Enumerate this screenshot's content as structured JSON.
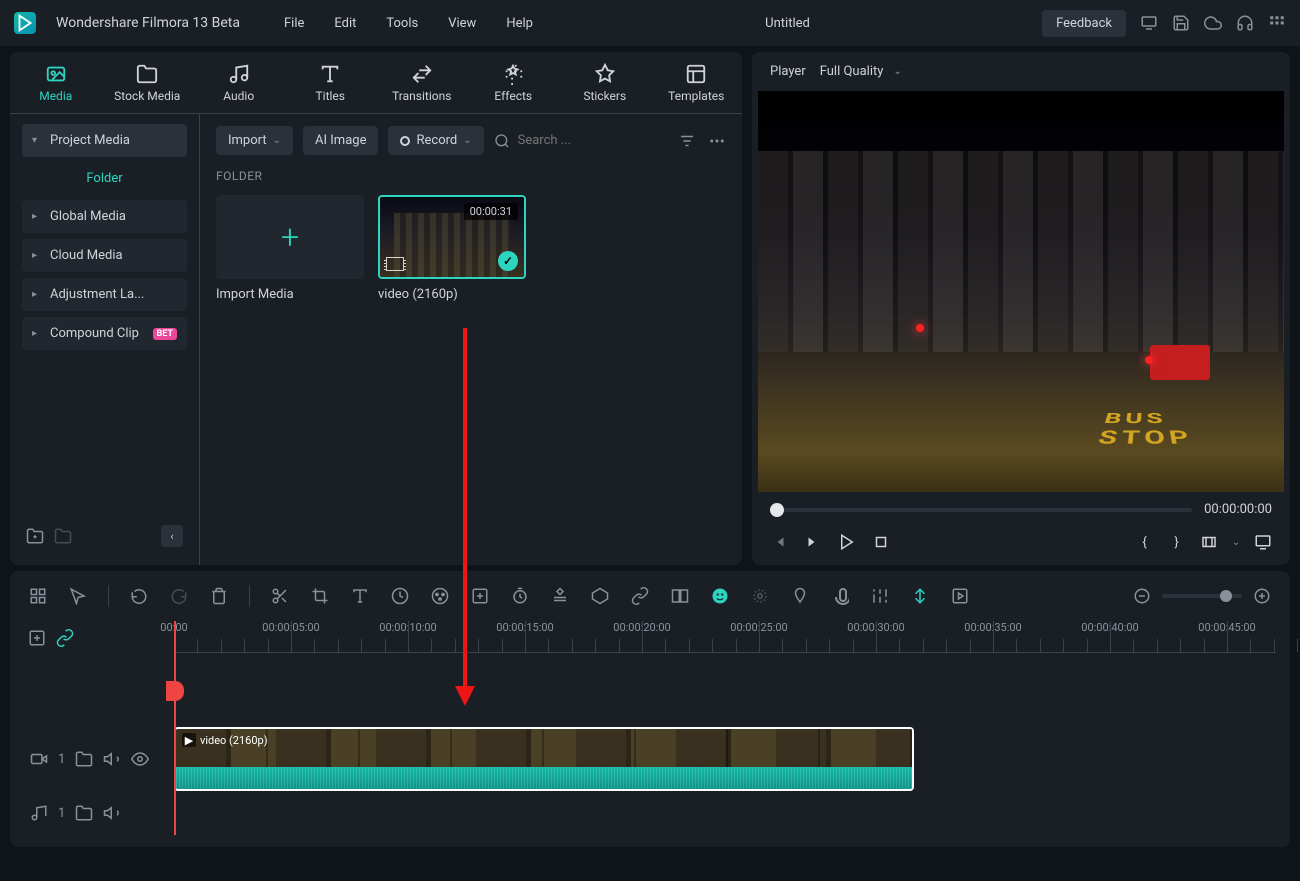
{
  "app": {
    "name": "Wondershare Filmora 13 Beta",
    "document": "Untitled"
  },
  "menu": {
    "file": "File",
    "edit": "Edit",
    "tools": "Tools",
    "view": "View",
    "help": "Help"
  },
  "header": {
    "feedback": "Feedback"
  },
  "tabs": {
    "media": "Media",
    "stock": "Stock Media",
    "audio": "Audio",
    "titles": "Titles",
    "transitions": "Transitions",
    "effects": "Effects",
    "stickers": "Stickers",
    "templates": "Templates"
  },
  "sidebar": {
    "project": "Project Media",
    "folder": "Folder",
    "global": "Global Media",
    "cloud": "Cloud Media",
    "adjustment": "Adjustment La...",
    "compound": "Compound Clip",
    "beta": "BET"
  },
  "toolbar": {
    "import": "Import",
    "aiimage": "AI Image",
    "record": "Record",
    "search_placeholder": "Search ..."
  },
  "content": {
    "folder_header": "FOLDER",
    "import_media": "Import Media",
    "clip_name": "video (2160p)",
    "clip_duration": "00:00:31"
  },
  "player": {
    "label": "Player",
    "quality": "Full Quality",
    "timecode": "00:00:00:00"
  },
  "timeline": {
    "ticks": [
      "00:00",
      "00:00:05:00",
      "00:00:10:00",
      "00:00:15:00",
      "00:00:20:00",
      "00:00:25:00",
      "00:00:30:00",
      "00:00:35:00",
      "00:00:40:00",
      "00:00:45:00"
    ],
    "video_track": "1",
    "audio_track": "1",
    "clip_label": "video (2160p)"
  }
}
